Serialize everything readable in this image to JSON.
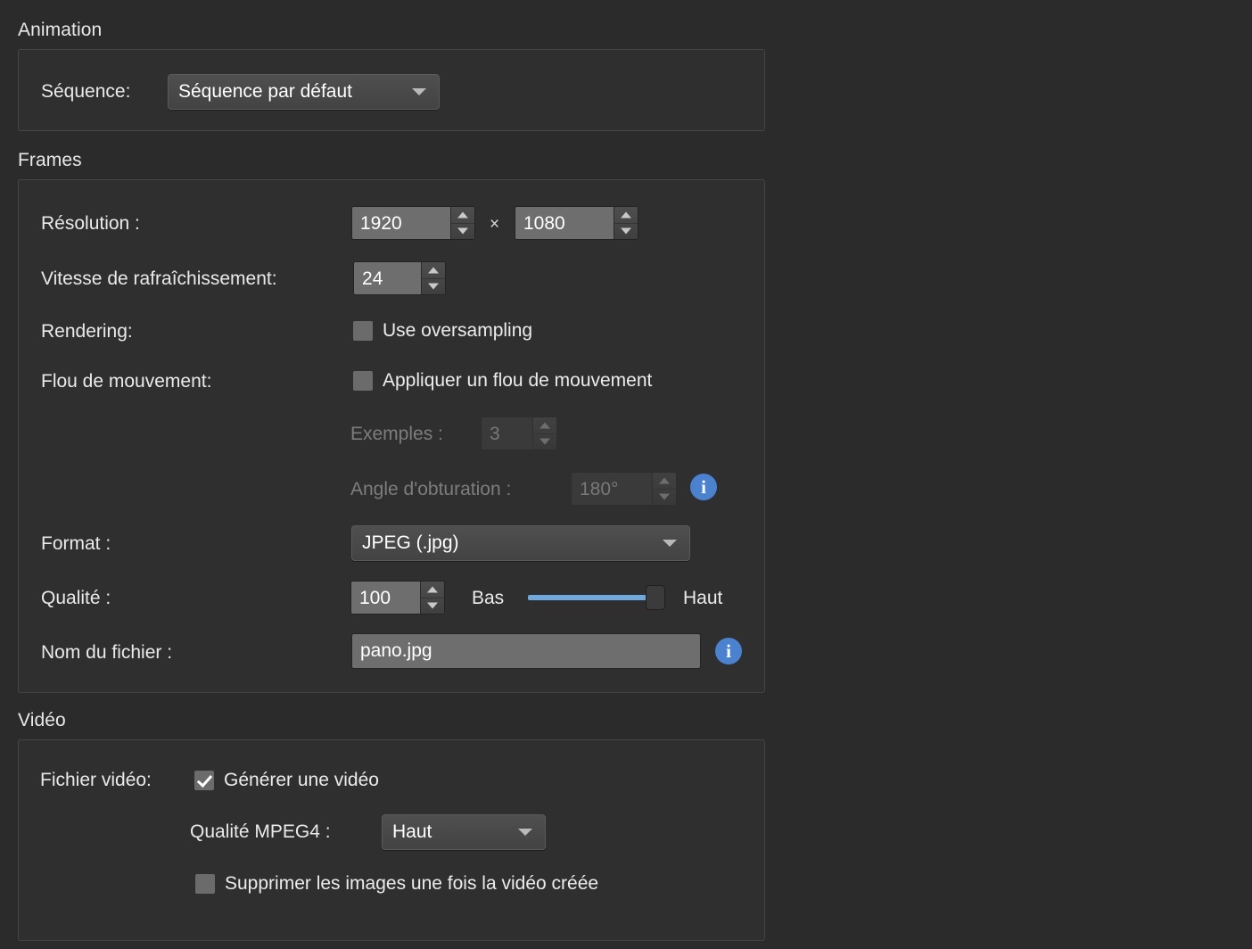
{
  "sections": {
    "animation": {
      "title": "Animation",
      "sequence_label": "Séquence:",
      "sequence_value": "Séquence par défaut"
    },
    "frames": {
      "title": "Frames",
      "resolution_label": "Résolution :",
      "resolution_width": "1920",
      "resolution_height": "1080",
      "resolution_separator": "×",
      "framerate_label": "Vitesse de rafraîchissement:",
      "framerate_value": "24",
      "rendering_label": "Rendering:",
      "oversampling_label": "Use oversampling",
      "oversampling_checked": false,
      "motionblur_label": "Flou de mouvement:",
      "motionblur_checkbox_label": "Appliquer un flou de mouvement",
      "motionblur_checked": false,
      "samples_label": "Exemples :",
      "samples_value": "3",
      "samples_disabled": true,
      "shutter_label": "Angle d'obturation :",
      "shutter_value": "180°",
      "shutter_disabled": true,
      "shutter_info_icon": "info-icon",
      "format_label": "Format :",
      "format_value": "JPEG (.jpg)",
      "quality_label": "Qualité :",
      "quality_value": "100",
      "quality_low_label": "Bas",
      "quality_high_label": "Haut",
      "quality_slider_percent": 100,
      "filename_label": "Nom du fichier :",
      "filename_value": "pano.jpg",
      "filename_info_icon": "info-icon"
    },
    "video": {
      "title": "Vidéo",
      "videofile_label": "Fichier vidéo:",
      "generate_video_label": "Générer une vidéo",
      "generate_video_checked": true,
      "mpeg4_quality_label": "Qualité MPEG4 :",
      "mpeg4_quality_value": "Haut",
      "delete_frames_label": "Supprimer les images une fois la vidéo créée",
      "delete_frames_checked": false
    }
  },
  "colors": {
    "background": "#2b2b2b",
    "group_background": "#2f2f2f",
    "group_border": "#454545",
    "field_background": "#6e6e6e",
    "combo_background": "#4b4b4b",
    "accent_blue": "#4a82d0",
    "slider_blue": "#6fa8dc",
    "text": "#eaeaea",
    "text_disabled": "#7d7d7d"
  }
}
